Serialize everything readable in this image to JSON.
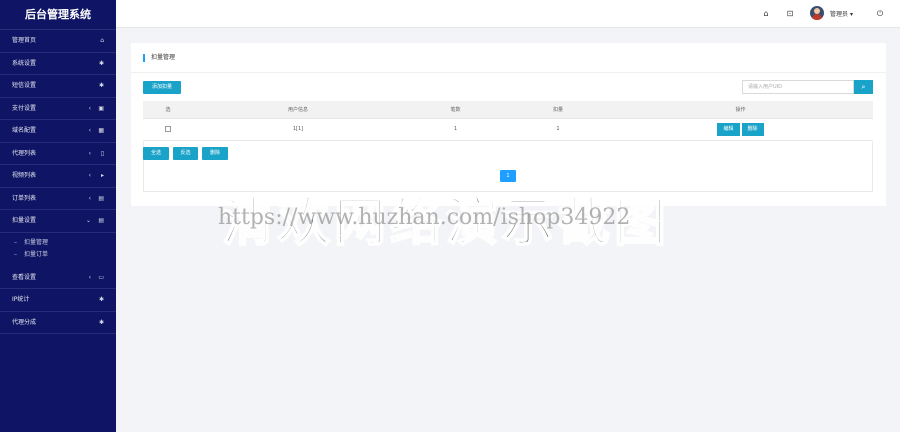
{
  "app": {
    "title": "后台管理系统"
  },
  "sidebar": {
    "items": [
      {
        "label": "管理首页",
        "icon": "home-icon",
        "glyph": "⌂",
        "arrow": ""
      },
      {
        "label": "系统设置",
        "icon": "gear-icon",
        "glyph": "✱",
        "arrow": ""
      },
      {
        "label": "短信设置",
        "icon": "gear-icon",
        "glyph": "✱",
        "arrow": ""
      },
      {
        "label": "支付设置",
        "icon": "credit-card-icon",
        "glyph": "▣",
        "arrow": "‹"
      },
      {
        "label": "域名配置",
        "icon": "calendar-icon",
        "glyph": "▦",
        "arrow": "‹"
      },
      {
        "label": "代理列表",
        "icon": "mobile-icon",
        "glyph": "▯",
        "arrow": "‹"
      },
      {
        "label": "视频列表",
        "icon": "play-icon",
        "glyph": "▸",
        "arrow": "‹"
      },
      {
        "label": "订单列表",
        "icon": "list-icon",
        "glyph": "▤",
        "arrow": "‹"
      },
      {
        "label": "扣量设置",
        "icon": "list-icon",
        "glyph": "▤",
        "arrow": "⌄"
      }
    ],
    "sub_items": [
      {
        "label": "扣量管理"
      },
      {
        "label": "扣量订单"
      }
    ],
    "items_after": [
      {
        "label": "查看设置",
        "icon": "monitor-icon",
        "glyph": "▭",
        "arrow": "‹"
      },
      {
        "label": "IP统计",
        "icon": "gear-icon",
        "glyph": "✱",
        "arrow": ""
      },
      {
        "label": "代理分成",
        "icon": "gear-icon",
        "glyph": "✱",
        "arrow": ""
      }
    ]
  },
  "topbar": {
    "home_glyph": "⌂",
    "fullscreen_glyph": "⊡",
    "admin_label": "管理员",
    "caret": "▾",
    "power_glyph": "⏻"
  },
  "page": {
    "title": "扣量管理",
    "add_button": "添加扣量",
    "search_placeholder": "请输入用户UID",
    "search_glyph": "⌕"
  },
  "table": {
    "headers": [
      "选",
      "用户信息",
      "笔数",
      "扣量",
      "操作"
    ],
    "rows": [
      {
        "user": "1[1]",
        "count": "1",
        "deduct": "1",
        "edit": "编辑",
        "delete": "删除"
      }
    ]
  },
  "bulk": {
    "select_all": "全选",
    "invert": "反选",
    "delete": "删除"
  },
  "pagination": {
    "current": "1"
  },
  "watermark": {
    "big": "清欢网络演示截图",
    "url": "https://www.huzhan.com/ishop34922"
  }
}
